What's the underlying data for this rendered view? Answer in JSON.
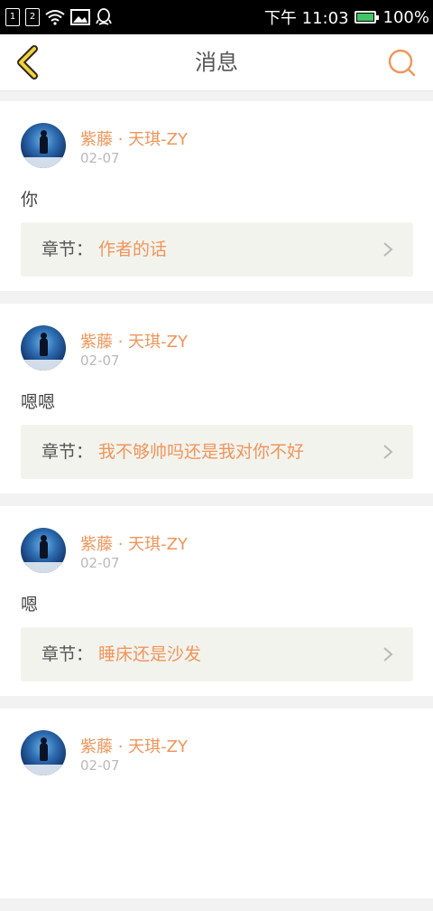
{
  "status_bar": {
    "sim1": "1",
    "sim2": "2",
    "time": "下午 11:03",
    "battery": "100%"
  },
  "header": {
    "title": "消息"
  },
  "chapter_prefix": "章节：",
  "messages": [
    {
      "username": "紫藤 · 天琪-ZY",
      "date": "02-07",
      "content": "你",
      "chapter": "作者的话"
    },
    {
      "username": "紫藤 · 天琪-ZY",
      "date": "02-07",
      "content": "嗯嗯",
      "chapter": "我不够帅吗还是我对你不好"
    },
    {
      "username": "紫藤 · 天琪-ZY",
      "date": "02-07",
      "content": "嗯",
      "chapter": "睡床还是沙发"
    },
    {
      "username": "紫藤 · 天琪-ZY",
      "date": "02-07",
      "content": "",
      "chapter": ""
    }
  ],
  "colors": {
    "accent": "#f0955a",
    "back_icon": "#f0d23c"
  }
}
